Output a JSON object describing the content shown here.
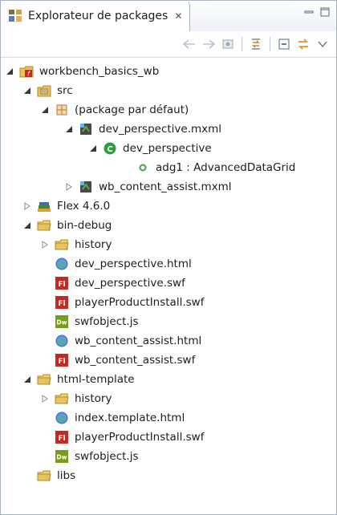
{
  "view": {
    "tab_title": "Explorateur de packages",
    "tab_close": "✕"
  },
  "toolbar": {
    "buttons": [
      "back-icon",
      "forward-icon",
      "home-icon",
      "link-with-editor-icon",
      "collapse-all-icon",
      "view-menu-icon"
    ]
  },
  "tree": {
    "items": [
      {
        "label": "workbench_basics_wb",
        "twisty": "expanded",
        "icon": "flex-project-icon"
      },
      {
        "label": "src",
        "twisty": "expanded",
        "icon": "source-folder-icon"
      },
      {
        "label": "(package par défaut)",
        "twisty": "expanded",
        "icon": "package-icon"
      },
      {
        "label": "dev_perspective.mxml",
        "twisty": "expanded",
        "icon": "mxml-file-icon"
      },
      {
        "label": "dev_perspective",
        "twisty": "expanded",
        "icon": "class-icon"
      },
      {
        "label": "adg1 : AdvancedDataGrid",
        "twisty": "none",
        "icon": "field-icon"
      },
      {
        "label": "wb_content_assist.mxml",
        "twisty": "collapsed",
        "icon": "mxml-file-icon"
      },
      {
        "label": "Flex 4.6.0",
        "twisty": "collapsed",
        "icon": "library-icon"
      },
      {
        "label": "bin-debug",
        "twisty": "expanded",
        "icon": "folder-icon"
      },
      {
        "label": "history",
        "twisty": "collapsed",
        "icon": "folder-icon"
      },
      {
        "label": "dev_perspective.html",
        "twisty": "none",
        "icon": "html-file-icon"
      },
      {
        "label": "dev_perspective.swf",
        "twisty": "none",
        "icon": "swf-file-icon"
      },
      {
        "label": "playerProductInstall.swf",
        "twisty": "none",
        "icon": "swf-file-icon"
      },
      {
        "label": "swfobject.js",
        "twisty": "none",
        "icon": "js-file-icon"
      },
      {
        "label": "wb_content_assist.html",
        "twisty": "none",
        "icon": "html-file-icon"
      },
      {
        "label": "wb_content_assist.swf",
        "twisty": "none",
        "icon": "swf-file-icon"
      },
      {
        "label": "html-template",
        "twisty": "expanded",
        "icon": "folder-icon"
      },
      {
        "label": "history",
        "twisty": "collapsed",
        "icon": "folder-icon"
      },
      {
        "label": "index.template.html",
        "twisty": "none",
        "icon": "html-file-icon"
      },
      {
        "label": "playerProductInstall.swf",
        "twisty": "none",
        "icon": "swf-file-icon"
      },
      {
        "label": "swfobject.js",
        "twisty": "none",
        "icon": "js-file-icon"
      },
      {
        "label": "libs",
        "twisty": "none",
        "icon": "folder-icon"
      }
    ]
  },
  "icon_text": {
    "swf": "Fl",
    "js": "Dw"
  },
  "colors": {
    "folder": "#e8c25a",
    "swf": "#c8281e",
    "js": "#7a9a1a",
    "class": "#2e9e3a",
    "field": "#3aa64a",
    "package": "#b07a3a"
  }
}
